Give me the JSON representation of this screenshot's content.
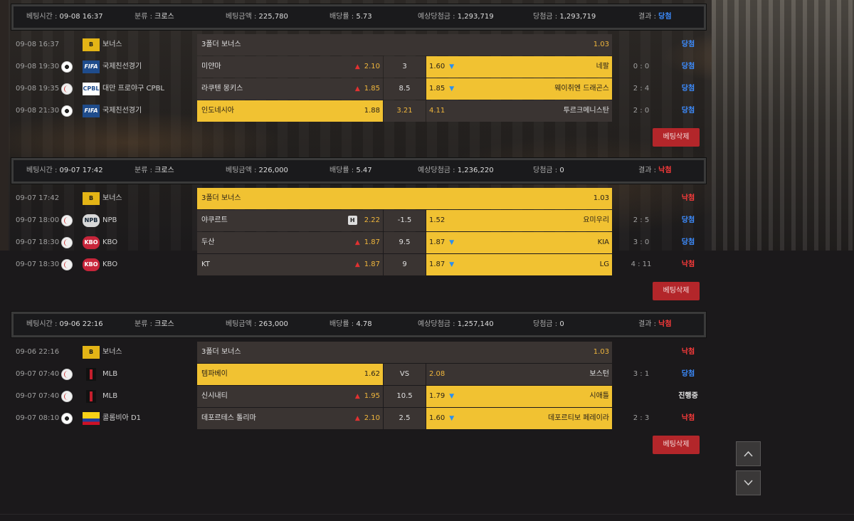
{
  "scroll": {
    "up_label": "▲",
    "down_label": "▼"
  },
  "groups": [
    {
      "header": {
        "time_label": "베팅시간 :",
        "time": "09-08 16:37",
        "type_label": "분류 :",
        "type": "크로스",
        "amount_label": "베팅금액 :",
        "amount": "225,780",
        "odds_label": "배당률 :",
        "odds": "5.73",
        "expected_label": "예상당첨금 :",
        "expected": "1,293,719",
        "win_label": "당첨금 :",
        "win": "1,293,719",
        "result_label": "결과 :",
        "result": "당첨",
        "result_type": "win"
      },
      "rows": [
        {
          "kind": "bonus",
          "date": "09-08 16:37",
          "flag_text": "B",
          "league": "보너스",
          "title": "3폴더 보너스",
          "odds": "1.03",
          "result": "당첨",
          "result_type": "win"
        },
        {
          "kind": "match",
          "date": "09-08 19:30",
          "sport": "soccer",
          "flag": "fifa",
          "flag_text": "FIFA",
          "league": "국제친선경기",
          "home": "미얀마",
          "home_odds": "2.10",
          "home_arrow": "up",
          "mid": "3",
          "away_odds": "1.60",
          "away_arrow": "down",
          "away": "네팔",
          "pick": "away",
          "score": "0 : 0",
          "result": "당첨",
          "result_type": "win"
        },
        {
          "kind": "match",
          "date": "09-08 19:35",
          "sport": "baseball",
          "flag": "cpbl",
          "flag_text": "CPBL",
          "league": "대만 프로야구 CPBL",
          "home": "라쿠텐 몽키스",
          "home_odds": "1.85",
          "home_arrow": "up",
          "mid": "8.5",
          "away_odds": "1.85",
          "away_arrow": "down",
          "away": "웨이취엔 드래곤스",
          "pick": "away",
          "score": "2 : 4",
          "result": "당첨",
          "result_type": "win"
        },
        {
          "kind": "match",
          "date": "09-08 21:30",
          "sport": "soccer",
          "flag": "fifa",
          "flag_text": "FIFA",
          "league": "국제친선경기",
          "home": "인도네시아",
          "home_odds": "1.88",
          "home_arrow": "",
          "mid": "3.21",
          "away_odds": "4.11",
          "away_arrow": "",
          "away": "투르크메니스탄",
          "pick": "home",
          "score": "2 : 0",
          "result": "당첨",
          "result_type": "win"
        }
      ],
      "delete_label": "베팅삭제"
    },
    {
      "header": {
        "time_label": "베팅시간 :",
        "time": "09-07 17:42",
        "type_label": "분류 :",
        "type": "크로스",
        "amount_label": "베팅금액 :",
        "amount": "226,000",
        "odds_label": "배당률 :",
        "odds": "5.47",
        "expected_label": "예상당첨금 :",
        "expected": "1,236,220",
        "win_label": "당첨금 :",
        "win": "0",
        "result_label": "결과 :",
        "result": "낙첨",
        "result_type": "lose"
      },
      "rows": [
        {
          "kind": "bonus",
          "date": "09-07 17:42",
          "flag_text": "B",
          "league": "보너스",
          "title": "3폴더 보너스",
          "odds": "1.03",
          "result": "낙첨",
          "result_type": "lose",
          "gold": true
        },
        {
          "kind": "match",
          "date": "09-07 18:00",
          "sport": "baseball",
          "flag": "npb",
          "flag_text": "NPB",
          "league": "NPB",
          "home": "야쿠르트",
          "home_badge": "H",
          "home_odds": "2.22",
          "home_arrow": "",
          "mid": "-1.5",
          "away_odds": "1.52",
          "away_arrow": "",
          "away": "요미우리",
          "pick": "away",
          "score": "2 : 5",
          "result": "당첨",
          "result_type": "win"
        },
        {
          "kind": "match",
          "date": "09-07 18:30",
          "sport": "baseball",
          "flag": "kbo",
          "flag_text": "KBO",
          "league": "KBO",
          "home": "두산",
          "home_odds": "1.87",
          "home_arrow": "up",
          "mid": "9.5",
          "away_odds": "1.87",
          "away_arrow": "down",
          "away": "KIA",
          "pick": "away",
          "score": "3 : 0",
          "result": "당첨",
          "result_type": "win"
        },
        {
          "kind": "match",
          "date": "09-07 18:30",
          "sport": "baseball",
          "flag": "kbo",
          "flag_text": "KBO",
          "league": "KBO",
          "home": "KT",
          "home_odds": "1.87",
          "home_arrow": "up",
          "mid": "9",
          "away_odds": "1.87",
          "away_arrow": "down",
          "away": "LG",
          "pick": "away",
          "score": "4 : 11",
          "result": "낙첨",
          "result_type": "lose"
        }
      ],
      "delete_label": "베팅삭제"
    },
    {
      "header": {
        "time_label": "베팅시간 :",
        "time": "09-06 22:16",
        "type_label": "분류 :",
        "type": "크로스",
        "amount_label": "베팅금액 :",
        "amount": "263,000",
        "odds_label": "배당률 :",
        "odds": "4.78",
        "expected_label": "예상당첨금 :",
        "expected": "1,257,140",
        "win_label": "당첨금 :",
        "win": "0",
        "result_label": "결과 :",
        "result": "낙첨",
        "result_type": "lose"
      },
      "rows": [
        {
          "kind": "bonus",
          "date": "09-06 22:16",
          "flag_text": "B",
          "league": "보너스",
          "title": "3폴더 보너스",
          "odds": "1.03",
          "result": "낙첨",
          "result_type": "lose"
        },
        {
          "kind": "match",
          "date": "09-07 07:40",
          "sport": "baseball",
          "flag": "mlb",
          "flag_text": "",
          "league": "MLB",
          "home": "템파베이",
          "home_odds": "1.62",
          "home_arrow": "",
          "mid": "VS",
          "away_odds": "2.08",
          "away_arrow": "",
          "away": "보스턴",
          "pick": "home",
          "score": "3 : 1",
          "result": "당첨",
          "result_type": "win"
        },
        {
          "kind": "match",
          "date": "09-07 07:40",
          "sport": "baseball",
          "flag": "mlb",
          "flag_text": "",
          "league": "MLB",
          "home": "신시내티",
          "home_odds": "1.95",
          "home_arrow": "up",
          "mid": "10.5",
          "away_odds": "1.79",
          "away_arrow": "down",
          "away": "시애틀",
          "pick": "away",
          "score": "",
          "result": "진행중",
          "result_type": "pend"
        },
        {
          "kind": "match",
          "date": "09-07 08:10",
          "sport": "soccer",
          "flag": "col",
          "flag_text": "",
          "league": "콜롬비아 D1",
          "home": "데포르테스 톨리마",
          "home_odds": "2.10",
          "home_arrow": "up",
          "mid": "2.5",
          "away_odds": "1.60",
          "away_arrow": "down",
          "away": "데포르티보 페레이라",
          "pick": "away",
          "score": "2 : 3",
          "result": "낙첨",
          "result_type": "lose"
        }
      ],
      "delete_label": "베팅삭제"
    }
  ]
}
